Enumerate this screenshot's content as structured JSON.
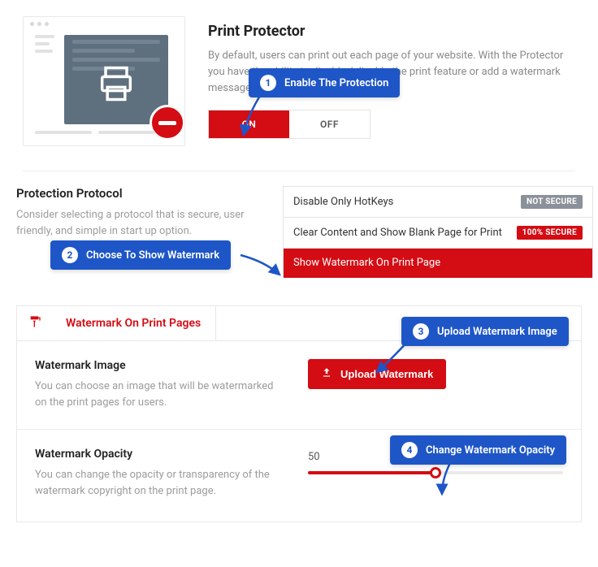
{
  "header": {
    "title": "Print Protector",
    "description": "By default, users can print out each page of your website. With the Protector you have the ability to disable / disable the print feature or add a watermark message to printed pages.",
    "toggle": {
      "on": "ON",
      "off": "OFF"
    }
  },
  "protocol": {
    "title": "Protection Protocol",
    "description": "Consider selecting a protocol that is secure, user friendly, and simple in start up option.",
    "options": [
      {
        "label": "Disable Only HotKeys",
        "badge": "NOT SECURE",
        "badge_type": "gray"
      },
      {
        "label": "Clear Content and Show Blank Page for Print",
        "badge": "100% SECURE",
        "badge_type": "red"
      },
      {
        "label": "Show Watermark On Print Page",
        "badge": "",
        "badge_type": ""
      }
    ]
  },
  "watermark": {
    "tab_label": "Watermark On Print Pages",
    "image": {
      "title": "Watermark Image",
      "desc": "You can choose an image that will be watermarked on the print pages for users.",
      "upload_label": "Upload Watermark"
    },
    "opacity": {
      "title": "Watermark Opacity",
      "desc": "You can change the opacity or transparency of the watermark copyright on the print page.",
      "value": "50",
      "percent": 50
    }
  },
  "annotations": {
    "a1": "Enable The Protection",
    "a2": "Choose To Show Watermark",
    "a3": "Upload Watermark Image",
    "a4": "Change Watermark Opacity"
  },
  "colors": {
    "primary": "#d40c13",
    "annotation": "#1e56c7"
  }
}
